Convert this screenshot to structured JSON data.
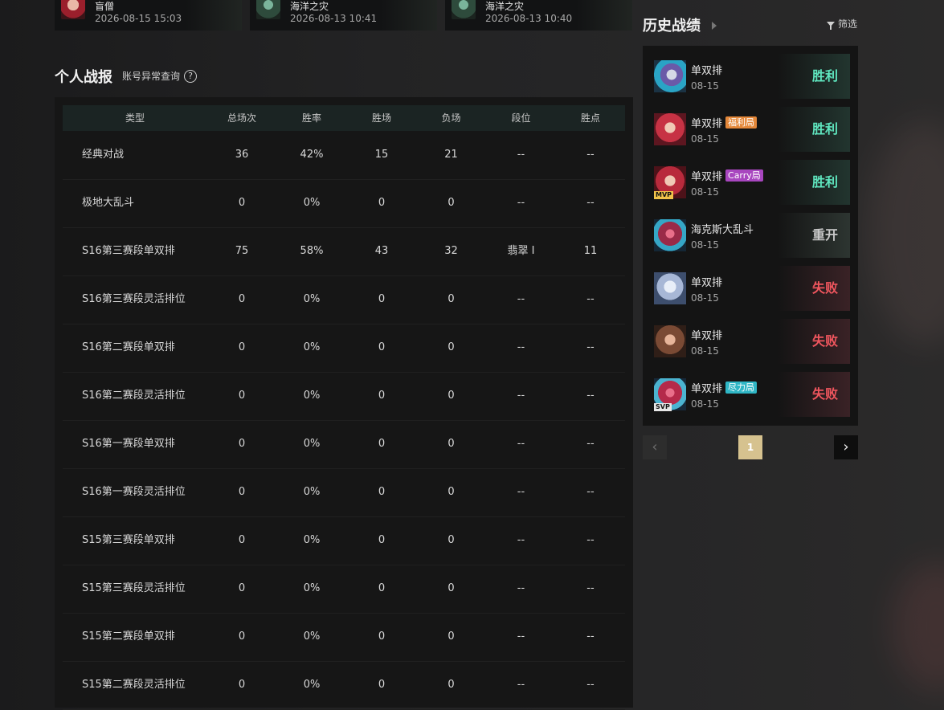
{
  "recent_matches": [
    {
      "name": "盲僧",
      "time": "2026-08-15 15:03"
    },
    {
      "name": "海洋之灾",
      "time": "2026-08-13 10:41"
    },
    {
      "name": "海洋之灾",
      "time": "2026-08-13 10:40"
    }
  ],
  "personal": {
    "title": "个人战报",
    "account_check": "账号异常查询",
    "help_icon": "?"
  },
  "table": {
    "headers": [
      "类型",
      "总场次",
      "胜率",
      "胜场",
      "负场",
      "段位",
      "胜点"
    ],
    "rows": [
      [
        "经典对战",
        "36",
        "42%",
        "15",
        "21",
        "--",
        "--"
      ],
      [
        "极地大乱斗",
        "0",
        "0%",
        "0",
        "0",
        "--",
        "--"
      ],
      [
        "S16第三赛段单双排",
        "75",
        "58%",
        "43",
        "32",
        "翡翠 Ⅰ",
        "11"
      ],
      [
        "S16第三赛段灵活排位",
        "0",
        "0%",
        "0",
        "0",
        "--",
        "--"
      ],
      [
        "S16第二赛段单双排",
        "0",
        "0%",
        "0",
        "0",
        "--",
        "--"
      ],
      [
        "S16第二赛段灵活排位",
        "0",
        "0%",
        "0",
        "0",
        "--",
        "--"
      ],
      [
        "S16第一赛段单双排",
        "0",
        "0%",
        "0",
        "0",
        "--",
        "--"
      ],
      [
        "S16第一赛段灵活排位",
        "0",
        "0%",
        "0",
        "0",
        "--",
        "--"
      ],
      [
        "S15第三赛段单双排",
        "0",
        "0%",
        "0",
        "0",
        "--",
        "--"
      ],
      [
        "S15第三赛段灵活排位",
        "0",
        "0%",
        "0",
        "0",
        "--",
        "--"
      ],
      [
        "S15第二赛段单双排",
        "0",
        "0%",
        "0",
        "0",
        "--",
        "--"
      ],
      [
        "S15第二赛段灵活排位",
        "0",
        "0%",
        "0",
        "0",
        "--",
        "--"
      ]
    ]
  },
  "history": {
    "title": "历史战绩",
    "filter_label": "筛选",
    "items": [
      {
        "mode": "单双排",
        "tag": "",
        "date": "08-15",
        "result": "胜利",
        "badge": ""
      },
      {
        "mode": "单双排",
        "tag": "福利局",
        "date": "08-15",
        "result": "胜利",
        "badge": ""
      },
      {
        "mode": "单双排",
        "tag": "Carry局",
        "date": "08-15",
        "result": "胜利",
        "badge": "MVP"
      },
      {
        "mode": "海克斯大乱斗",
        "tag": "",
        "date": "08-15",
        "result": "重开",
        "badge": ""
      },
      {
        "mode": "单双排",
        "tag": "",
        "date": "08-15",
        "result": "失败",
        "badge": ""
      },
      {
        "mode": "单双排",
        "tag": "",
        "date": "08-15",
        "result": "失败",
        "badge": ""
      },
      {
        "mode": "单双排",
        "tag": "尽力局",
        "date": "08-15",
        "result": "失败",
        "badge": "SVP"
      }
    ]
  },
  "pagination": {
    "prev": "‹",
    "current": "1",
    "next": "›"
  }
}
